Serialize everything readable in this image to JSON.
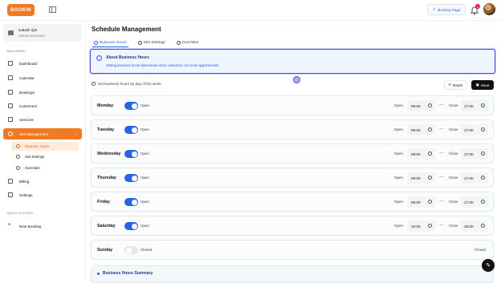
{
  "app": {
    "logo": "BOOKIN",
    "booking_page": "Booking Page",
    "notifications": "2"
  },
  "user": {
    "name": "subash rijal",
    "id": "4WK0DL9zOd2IZnH"
  },
  "sidebar": {
    "main_menu": "MAIN MENU",
    "items": [
      {
        "label": "Dashboard",
        "icon": "dashboard-icon"
      },
      {
        "label": "Calendar",
        "icon": "calendar-icon"
      },
      {
        "label": "Bookings",
        "icon": "bookings-icon"
      },
      {
        "label": "Customers",
        "icon": "customers-icon"
      },
      {
        "label": "Services",
        "icon": "services-icon"
      },
      {
        "label": "Slot Management",
        "icon": "clock-icon"
      }
    ],
    "subitems": [
      {
        "label": "Business Hours"
      },
      {
        "label": "Slot Settings"
      },
      {
        "label": "Overrides"
      }
    ],
    "items2": [
      {
        "label": "Billing",
        "icon": "billing-icon"
      },
      {
        "label": "Settings",
        "icon": "settings-icon"
      }
    ],
    "quick_actions": "QUICK ACTIONS",
    "new_booking": "New Booking"
  },
  "page": {
    "title": "Schedule Management",
    "tabs": [
      {
        "label": "Business Hours"
      },
      {
        "label": "Slot Settings"
      },
      {
        "label": "Overrides"
      }
    ],
    "info_title": "About Business Hours",
    "info_desc": "Setting business hours determines when customers can book appointments",
    "set_label": "Set business hours by day of the week",
    "reset": "Reset",
    "save": "Save",
    "open_label": "Open",
    "close_label": "Close",
    "dash": "—",
    "summary_title": "Business Hours Summary"
  },
  "days": [
    {
      "day": "Monday",
      "status": "Open",
      "open": "09:00",
      "close": "17:00",
      "enabled": true
    },
    {
      "day": "Tuesday",
      "status": "Open",
      "open": "09:00",
      "close": "17:00",
      "enabled": true
    },
    {
      "day": "Wednesday",
      "status": "Open",
      "open": "09:00",
      "close": "17:00",
      "enabled": true
    },
    {
      "day": "Thursday",
      "status": "Open",
      "open": "09:00",
      "close": "17:00",
      "enabled": true
    },
    {
      "day": "Friday",
      "status": "Open",
      "open": "09:00",
      "close": "17:00",
      "enabled": true
    },
    {
      "day": "Saturday",
      "status": "Open",
      "open": "10:00",
      "close": "16:00",
      "enabled": true
    },
    {
      "day": "Sunday",
      "status": "Closed",
      "right": "Closed",
      "enabled": false
    }
  ],
  "colors": {
    "accent": "#f07a24",
    "primary": "#2563eb",
    "info_border": "#4f46e5"
  }
}
